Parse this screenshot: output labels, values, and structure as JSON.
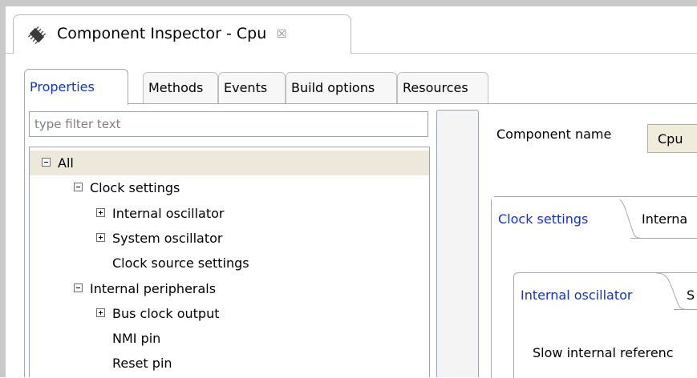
{
  "editor": {
    "title": "Component Inspector - Cpu",
    "close_glyph": "☒",
    "chip_icon": "cpu-chip-icon"
  },
  "left_tabs": [
    "Properties",
    "Methods",
    "Events",
    "Build options",
    "Resources"
  ],
  "filter": {
    "placeholder": "type filter text",
    "value": ""
  },
  "tree": [
    {
      "label": "All",
      "level": 0,
      "state": "expanded",
      "selected": true
    },
    {
      "label": "Clock settings",
      "level": 1,
      "state": "expanded"
    },
    {
      "label": "Internal oscillator",
      "level": 2,
      "state": "collapsed"
    },
    {
      "label": "System oscillator",
      "level": 2,
      "state": "collapsed"
    },
    {
      "label": "Clock source settings",
      "level": 2,
      "state": "leaf"
    },
    {
      "label": "Internal peripherals",
      "level": 1,
      "state": "expanded"
    },
    {
      "label": "Bus clock output",
      "level": 2,
      "state": "collapsed"
    },
    {
      "label": "NMI pin",
      "level": 2,
      "state": "leaf"
    },
    {
      "label": "Reset pin",
      "level": 2,
      "state": "leaf"
    }
  ],
  "right": {
    "component_label": "Component name",
    "component_value": "Cpu",
    "tab_active": "Clock settings",
    "tab_next": "Interna",
    "inner_tab_active": "Internal oscillator",
    "inner_tab_next": "S",
    "field_label": "Slow internal referenc"
  },
  "colors": {
    "accent": "#1533c6",
    "selection": "#ece8db",
    "field_bg": "#f0ecdc"
  }
}
